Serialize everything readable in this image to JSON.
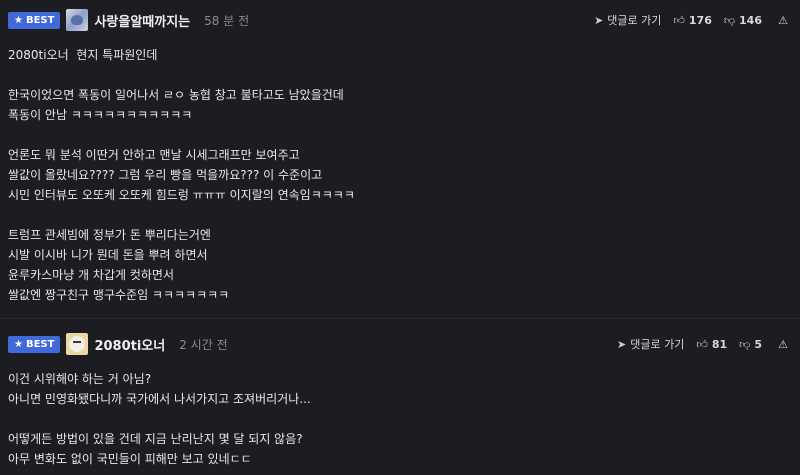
{
  "comments": [
    {
      "badge": "BEST",
      "nickname": "사랑을알때까지는",
      "time": "58 분 전",
      "reply_label": "댓글로 가기",
      "likes": "176",
      "dislikes": "146",
      "lines": [
        "2080ti오너  현지 특파원인데",
        "",
        "한국이었으면 폭동이 일어나서 ㄹㅇ 농협 창고 불타고도 남았을건데",
        "폭동이 안남 ㅋㅋㅋㅋㅋㅋㅋㅋㅋㅋㅋ",
        "",
        "언론도 뭐 분석 이딴거 안하고 맨날 시세그래프만 보여주고",
        "쌀값이 올랐네요???? 그럼 우리 빵을 먹을까요??? 이 수준이고",
        "시민 인터뷰도 오또케 오또케 힘드렁 ㅠㅠㅠ 이지랄의 연속임ㅋㅋㅋㅋ",
        "",
        "트럼프 관세빔에 정부가 돈 뿌리다는거엔",
        "시발 이시바 니가 뭔데 돈을 뿌려 하면서",
        "윤루카스마냥 개 차갑게 컷하면서",
        "쌀값엔 짱구친구 맹구수준임 ㅋㅋㅋㅋㅋㅋㅋ"
      ]
    },
    {
      "badge": "BEST",
      "nickname": "2080ti오너",
      "time": "2 시간 전",
      "reply_label": "댓글로 가기",
      "likes": "81",
      "dislikes": "5",
      "lines": [
        "이건 시위해야 하는 거 아님?",
        "아니면 민영화됐다니까 국가에서 나서가지고 조져버리거나...",
        "",
        "어떻게든 방법이 있을 건데 지금 난리난지 몇 달 되지 않음?",
        "아무 변화도 없이 국민들이 피해만 보고 있네ㄷㄷ"
      ]
    }
  ]
}
